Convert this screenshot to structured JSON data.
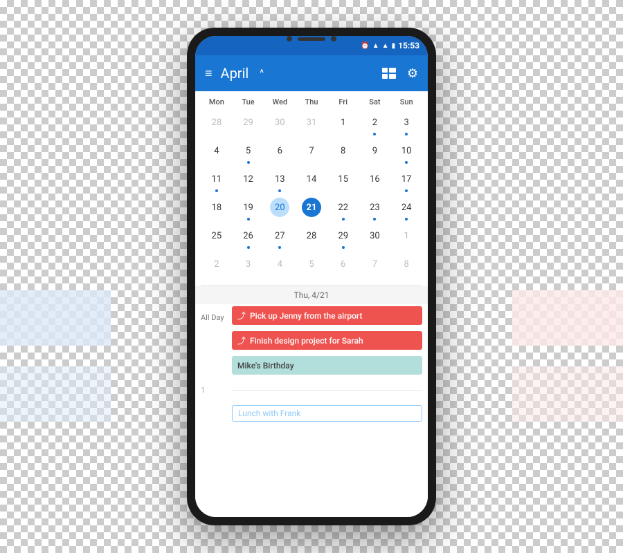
{
  "phone": {
    "status_bar": {
      "time": "15:53",
      "icons": [
        "alarm",
        "wifi",
        "signal",
        "battery"
      ]
    },
    "app_bar": {
      "menu_icon": "≡",
      "title": "April",
      "chevron": "^",
      "view_icon": "⊞",
      "settings_icon": "⚙"
    },
    "calendar": {
      "day_headers": [
        "Mon",
        "Tue",
        "Wed",
        "Thu",
        "Fri",
        "Sat",
        "Sun"
      ],
      "weeks": [
        [
          {
            "day": "28",
            "outside": true,
            "dot": false
          },
          {
            "day": "29",
            "outside": true,
            "dot": false
          },
          {
            "day": "30",
            "outside": true,
            "dot": false
          },
          {
            "day": "31",
            "outside": true,
            "dot": false
          },
          {
            "day": "1",
            "outside": false,
            "dot": false
          },
          {
            "day": "2",
            "outside": false,
            "dot": true
          },
          {
            "day": "3",
            "outside": false,
            "dot": true
          }
        ],
        [
          {
            "day": "4",
            "outside": false,
            "dot": false
          },
          {
            "day": "5",
            "outside": false,
            "dot": true
          },
          {
            "day": "6",
            "outside": false,
            "dot": false
          },
          {
            "day": "7",
            "outside": false,
            "dot": false
          },
          {
            "day": "8",
            "outside": false,
            "dot": false
          },
          {
            "day": "9",
            "outside": false,
            "dot": false
          },
          {
            "day": "10",
            "outside": false,
            "dot": true
          }
        ],
        [
          {
            "day": "11",
            "outside": false,
            "dot": true
          },
          {
            "day": "12",
            "outside": false,
            "dot": false
          },
          {
            "day": "13",
            "outside": false,
            "dot": true
          },
          {
            "day": "14",
            "outside": false,
            "dot": false
          },
          {
            "day": "15",
            "outside": false,
            "dot": false
          },
          {
            "day": "16",
            "outside": false,
            "dot": false
          },
          {
            "day": "17",
            "outside": false,
            "dot": true
          }
        ],
        [
          {
            "day": "18",
            "outside": false,
            "dot": false
          },
          {
            "day": "19",
            "outside": false,
            "dot": true
          },
          {
            "day": "20",
            "outside": false,
            "dot": false,
            "selected_light": true
          },
          {
            "day": "21",
            "outside": false,
            "dot": false,
            "today": true
          },
          {
            "day": "22",
            "outside": false,
            "dot": true
          },
          {
            "day": "23",
            "outside": false,
            "dot": true
          },
          {
            "day": "24",
            "outside": false,
            "dot": true
          }
        ],
        [
          {
            "day": "25",
            "outside": false,
            "dot": false
          },
          {
            "day": "26",
            "outside": false,
            "dot": true
          },
          {
            "day": "27",
            "outside": false,
            "dot": true
          },
          {
            "day": "28",
            "outside": false,
            "dot": false
          },
          {
            "day": "29",
            "outside": false,
            "dot": true
          },
          {
            "day": "30",
            "outside": false,
            "dot": false
          },
          {
            "day": "1",
            "outside": true,
            "dot": false
          }
        ],
        [
          {
            "day": "2",
            "outside": true,
            "dot": false
          },
          {
            "day": "3",
            "outside": true,
            "dot": false
          },
          {
            "day": "4",
            "outside": true,
            "dot": false
          },
          {
            "day": "5",
            "outside": true,
            "dot": false
          },
          {
            "day": "6",
            "outside": true,
            "dot": false
          },
          {
            "day": "7",
            "outside": true,
            "dot": false
          },
          {
            "day": "8",
            "outside": true,
            "dot": false
          }
        ]
      ]
    },
    "date_label": "Thu, 4/21",
    "events": [
      {
        "time": "All Day",
        "title": "Pick up Jenny from the airport",
        "color": "red",
        "icon": "↑"
      },
      {
        "time": "",
        "title": "Finish design project for Sarah",
        "color": "red",
        "icon": "↑"
      },
      {
        "time": "",
        "title": "Mike's Birthday",
        "color": "teal",
        "icon": ""
      }
    ],
    "time_slots": [
      {
        "time": "1",
        "event": null
      },
      {
        "time": "",
        "event": "Lunch with Frank"
      }
    ]
  }
}
